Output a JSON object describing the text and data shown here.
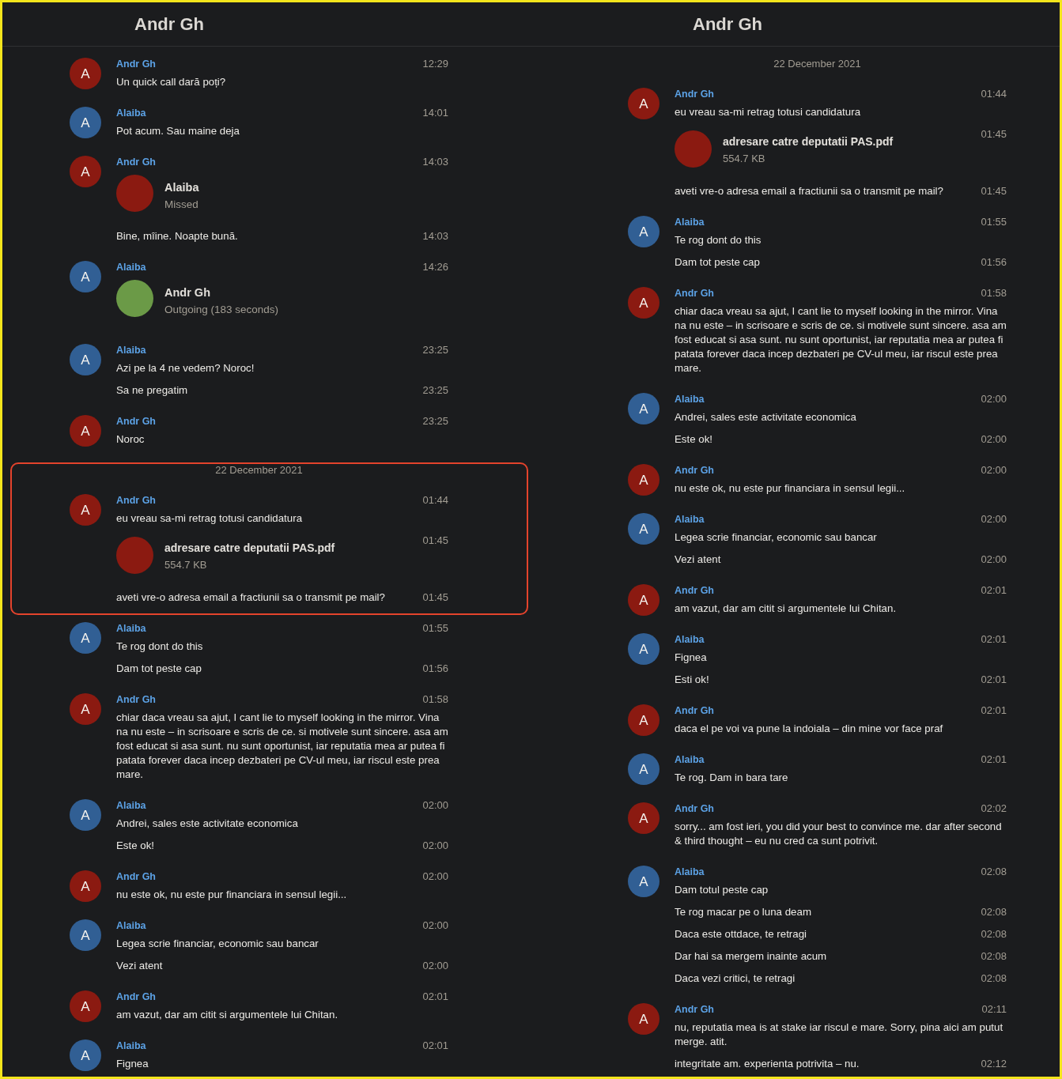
{
  "panels": [
    {
      "title": "Andr Gh",
      "sections": [
        {
          "highlighted": false,
          "items": [
            {
              "kind": "group",
              "sender": "Andr Gh",
              "avatar": "A",
              "color": "#8b1a11",
              "time": "12:29",
              "messages": [
                {
                  "kind": "text",
                  "text": "Un quick call dară poți?"
                }
              ]
            },
            {
              "kind": "group",
              "sender": "Alaiba",
              "avatar": "A",
              "color": "#315f94",
              "time": "14:01",
              "messages": [
                {
                  "kind": "text",
                  "text": "Pot acum. Sau maine deja"
                }
              ]
            },
            {
              "kind": "group",
              "sender": "Andr Gh",
              "avatar": "A",
              "color": "#8b1a11",
              "time": "14:03",
              "messages": [
                {
                  "kind": "call",
                  "title": "Alaiba",
                  "status": "Missed",
                  "color": "#8b1a11"
                },
                {
                  "kind": "text",
                  "text": "Bine, mîine. Noapte bună.",
                  "time": "14:03"
                }
              ]
            },
            {
              "kind": "group",
              "sender": "Alaiba",
              "avatar": "A",
              "color": "#315f94",
              "time": "14:26",
              "messages": [
                {
                  "kind": "call",
                  "title": "Andr Gh",
                  "status": "Outgoing (183 seconds)",
                  "color": "#6b9a47"
                }
              ]
            },
            {
              "kind": "group",
              "sender": "Alaiba",
              "avatar": "A",
              "color": "#315f94",
              "time": "23:25",
              "messages": [
                {
                  "kind": "text",
                  "text": "Azi pe la 4 ne vedem? Noroc!"
                },
                {
                  "kind": "text",
                  "text": "Sa ne pregatim",
                  "time": "23:25"
                }
              ]
            },
            {
              "kind": "group",
              "sender": "Andr Gh",
              "avatar": "A",
              "color": "#8b1a11",
              "time": "23:25",
              "messages": [
                {
                  "kind": "text",
                  "text": "Noroc"
                }
              ]
            }
          ]
        },
        {
          "highlighted": true,
          "items": [
            {
              "kind": "date",
              "text": "22 December 2021"
            },
            {
              "kind": "group",
              "sender": "Andr Gh",
              "avatar": "A",
              "color": "#8b1a11",
              "time": "01:44",
              "messages": [
                {
                  "kind": "text",
                  "text": "eu vreau sa-mi retrag totusi candidatura"
                },
                {
                  "kind": "file",
                  "name": "adresare catre deputatii PAS.pdf",
                  "size": "554.7 KB",
                  "color": "#8b1a11",
                  "time": "01:45"
                },
                {
                  "kind": "text",
                  "text": "aveti vre-o adresa email a fractiunii sa o transmit pe mail?",
                  "time": "01:45"
                }
              ]
            }
          ]
        },
        {
          "highlighted": false,
          "items": [
            {
              "kind": "group",
              "sender": "Alaiba",
              "avatar": "A",
              "color": "#315f94",
              "time": "01:55",
              "messages": [
                {
                  "kind": "text",
                  "text": "Te rog dont do this"
                },
                {
                  "kind": "text",
                  "text": "Dam tot peste cap",
                  "time": "01:56"
                }
              ]
            },
            {
              "kind": "group",
              "sender": "Andr Gh",
              "avatar": "A",
              "color": "#8b1a11",
              "time": "01:58",
              "messages": [
                {
                  "kind": "text",
                  "text": "chiar daca vreau sa ajut, I cant lie to myself looking in the mirror. Vina na nu este – in scrisoare e scris de ce. si motivele sunt sincere. asa am fost educat si asa sunt. nu sunt oportunist, iar reputatia mea ar putea fi patata forever daca incep dezbateri pe CV-ul meu, iar riscul este prea mare."
                }
              ]
            },
            {
              "kind": "group",
              "sender": "Alaiba",
              "avatar": "A",
              "color": "#315f94",
              "time": "02:00",
              "messages": [
                {
                  "kind": "text",
                  "text": "Andrei, sales este activitate economica"
                },
                {
                  "kind": "text",
                  "text": "Este ok!",
                  "time": "02:00"
                }
              ]
            },
            {
              "kind": "group",
              "sender": "Andr Gh",
              "avatar": "A",
              "color": "#8b1a11",
              "time": "02:00",
              "messages": [
                {
                  "kind": "text",
                  "text": "nu este ok, nu este pur financiara in sensul legii..."
                }
              ]
            },
            {
              "kind": "group",
              "sender": "Alaiba",
              "avatar": "A",
              "color": "#315f94",
              "time": "02:00",
              "messages": [
                {
                  "kind": "text",
                  "text": "Legea scrie financiar, economic sau bancar"
                },
                {
                  "kind": "text",
                  "text": "Vezi atent",
                  "time": "02:00"
                }
              ]
            },
            {
              "kind": "group",
              "sender": "Andr Gh",
              "avatar": "A",
              "color": "#8b1a11",
              "time": "02:01",
              "messages": [
                {
                  "kind": "text",
                  "text": "am vazut, dar am citit si argumentele lui Chitan."
                }
              ]
            },
            {
              "kind": "group",
              "sender": "Alaiba",
              "avatar": "A",
              "color": "#315f94",
              "time": "02:01",
              "messages": [
                {
                  "kind": "text",
                  "text": "Fignea"
                }
              ]
            }
          ]
        }
      ]
    },
    {
      "title": "Andr Gh",
      "sections": [
        {
          "highlighted": false,
          "items": [
            {
              "kind": "date",
              "text": "22 December 2021"
            },
            {
              "kind": "group",
              "sender": "Andr Gh",
              "avatar": "A",
              "color": "#8b1a11",
              "time": "01:44",
              "messages": [
                {
                  "kind": "text",
                  "text": "eu vreau sa-mi retrag totusi candidatura"
                },
                {
                  "kind": "file",
                  "name": "adresare catre deputatii PAS.pdf",
                  "size": "554.7 KB",
                  "color": "#8b1a11",
                  "time": "01:45"
                },
                {
                  "kind": "text",
                  "text": "aveti vre-o adresa email a fractiunii sa o transmit pe mail?",
                  "time": "01:45"
                }
              ]
            },
            {
              "kind": "group",
              "sender": "Alaiba",
              "avatar": "A",
              "color": "#315f94",
              "time": "01:55",
              "messages": [
                {
                  "kind": "text",
                  "text": "Te rog dont do this"
                },
                {
                  "kind": "text",
                  "text": "Dam tot peste cap",
                  "time": "01:56"
                }
              ]
            },
            {
              "kind": "group",
              "sender": "Andr Gh",
              "avatar": "A",
              "color": "#8b1a11",
              "time": "01:58",
              "messages": [
                {
                  "kind": "text",
                  "text": "chiar daca vreau sa ajut, I cant lie to myself looking in the mirror. Vina na nu este – in scrisoare e scris de ce. si motivele sunt sincere. asa am fost educat si asa sunt. nu sunt oportunist, iar reputatia mea ar putea fi patata forever daca incep dezbateri pe CV-ul meu, iar riscul este prea mare."
                }
              ]
            },
            {
              "kind": "group",
              "sender": "Alaiba",
              "avatar": "A",
              "color": "#315f94",
              "time": "02:00",
              "messages": [
                {
                  "kind": "text",
                  "text": "Andrei, sales este activitate economica"
                },
                {
                  "kind": "text",
                  "text": "Este ok!",
                  "time": "02:00"
                }
              ]
            },
            {
              "kind": "group",
              "sender": "Andr Gh",
              "avatar": "A",
              "color": "#8b1a11",
              "time": "02:00",
              "messages": [
                {
                  "kind": "text",
                  "text": "nu este ok, nu este pur financiara in sensul legii..."
                }
              ]
            },
            {
              "kind": "group",
              "sender": "Alaiba",
              "avatar": "A",
              "color": "#315f94",
              "time": "02:00",
              "messages": [
                {
                  "kind": "text",
                  "text": "Legea scrie financiar, economic sau bancar"
                },
                {
                  "kind": "text",
                  "text": "Vezi atent",
                  "time": "02:00"
                }
              ]
            },
            {
              "kind": "group",
              "sender": "Andr Gh",
              "avatar": "A",
              "color": "#8b1a11",
              "time": "02:01",
              "messages": [
                {
                  "kind": "text",
                  "text": "am vazut, dar am citit si argumentele lui Chitan."
                }
              ]
            },
            {
              "kind": "group",
              "sender": "Alaiba",
              "avatar": "A",
              "color": "#315f94",
              "time": "02:01",
              "messages": [
                {
                  "kind": "text",
                  "text": "Fignea"
                },
                {
                  "kind": "text",
                  "text": "Esti ok!",
                  "time": "02:01"
                }
              ]
            },
            {
              "kind": "group",
              "sender": "Andr Gh",
              "avatar": "A",
              "color": "#8b1a11",
              "time": "02:01",
              "messages": [
                {
                  "kind": "text",
                  "text": "daca el pe voi va pune la indoiala – din mine vor face praf"
                }
              ]
            },
            {
              "kind": "group",
              "sender": "Alaiba",
              "avatar": "A",
              "color": "#315f94",
              "time": "02:01",
              "messages": [
                {
                  "kind": "text",
                  "text": "Te rog. Dam in bara tare"
                }
              ]
            },
            {
              "kind": "group",
              "sender": "Andr Gh",
              "avatar": "A",
              "color": "#8b1a11",
              "time": "02:02",
              "messages": [
                {
                  "kind": "text",
                  "text": "sorry... am fost ieri, you did your best to convince me. dar after second & third thought – eu nu cred ca sunt potrivit."
                }
              ]
            },
            {
              "kind": "group",
              "sender": "Alaiba",
              "avatar": "A",
              "color": "#315f94",
              "time": "02:08",
              "messages": [
                {
                  "kind": "text",
                  "text": "Dam totul peste cap"
                },
                {
                  "kind": "text",
                  "text": "Te rog macar pe o luna deam",
                  "time": "02:08"
                },
                {
                  "kind": "text",
                  "text": "Daca este ottdace, te retragi",
                  "time": "02:08"
                },
                {
                  "kind": "text",
                  "text": "Dar hai sa mergem inainte acum",
                  "time": "02:08"
                },
                {
                  "kind": "text",
                  "text": "Daca vezi critici, te retragi",
                  "time": "02:08"
                }
              ]
            },
            {
              "kind": "group",
              "sender": "Andr Gh",
              "avatar": "A",
              "color": "#8b1a11",
              "time": "02:11",
              "messages": [
                {
                  "kind": "text",
                  "text": "nu, reputatia mea is at stake iar riscul e mare. Sorry, pina aici am putut merge. atit."
                },
                {
                  "kind": "text",
                  "text": "integritate am. experienta potrivita – nu.",
                  "time": "02:12"
                }
              ]
            }
          ]
        }
      ]
    }
  ]
}
